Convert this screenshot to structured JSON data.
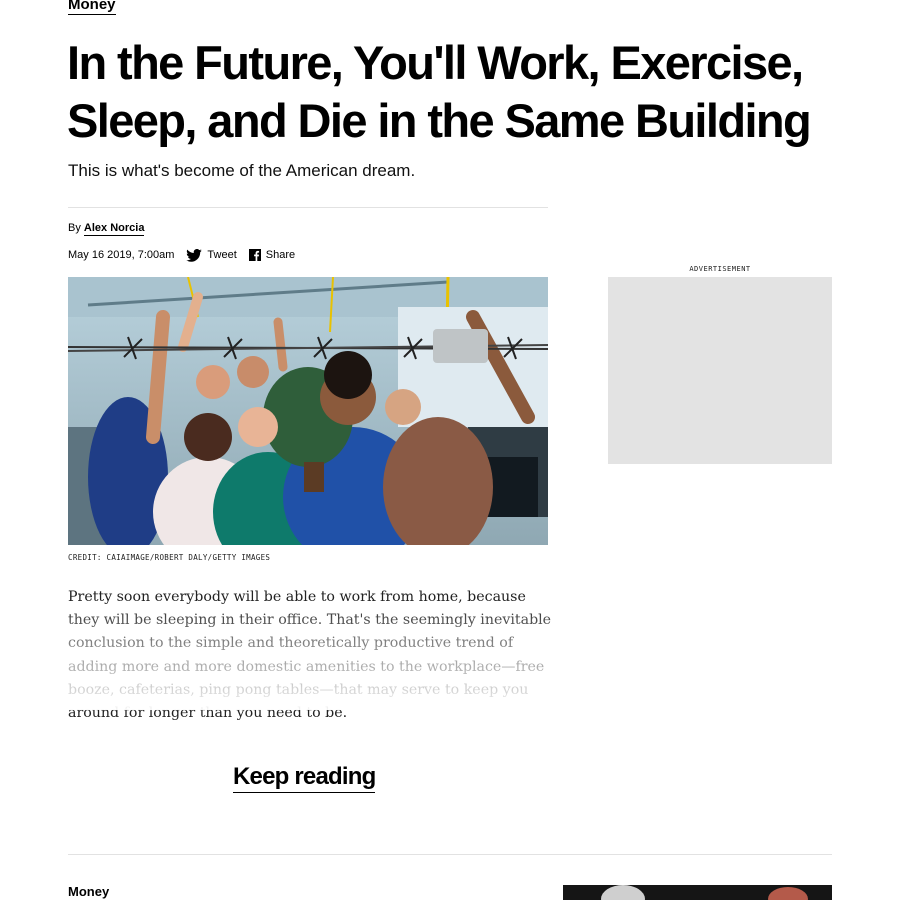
{
  "article": {
    "section": "Money",
    "headline": "In the Future, You'll Work, Exercise, Sleep, and Die in the Same Building",
    "dek": "This is what's become of the American dream.",
    "byline_prefix": "By",
    "author": "Alex Norcia",
    "date": "May 16 2019, 7:00am",
    "share": {
      "tweet_label": "Tweet",
      "share_label": "Share"
    },
    "image_credit": "CREDIT: CAIAIMAGE/ROBERT DALY/GETTY IMAGES",
    "body": "Pretty soon everybody will be able to work from home, because they will be sleeping in their office. That's the seemingly inevitable conclusion to the simple and theoretically productive trend of adding more and more domestic amenities to the workplace—free booze, cafeterias, ping pong tables—that may serve to keep you around for longer than you need to be.",
    "keep_reading_label": "Keep reading"
  },
  "sidebar": {
    "ad_label": "ADVERTISEMENT"
  },
  "next_article": {
    "section": "Money"
  },
  "icons": {
    "tweet": "twitter-bird-icon",
    "share": "facebook-f-icon"
  }
}
